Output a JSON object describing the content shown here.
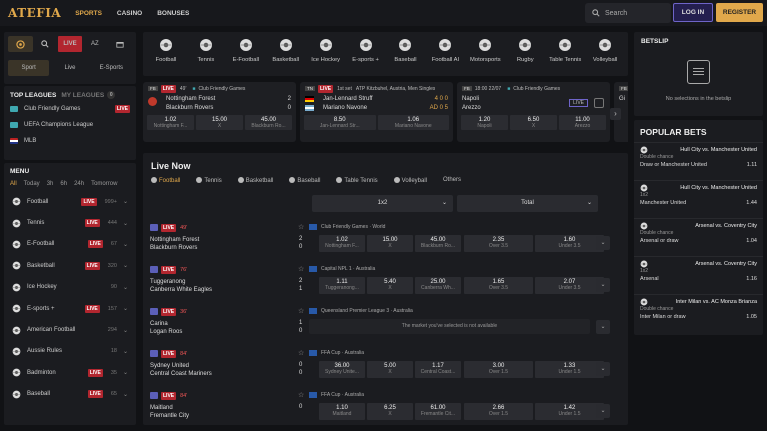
{
  "header": {
    "logo": "ATEFIA",
    "nav": [
      "SPORTS",
      "CASINO",
      "BONUSES"
    ],
    "search_placeholder": "Search",
    "login": "LOG IN",
    "register": "REGISTER"
  },
  "quick": {
    "live": "LIVE",
    "az": "AZ",
    "tabs": [
      "Sport",
      "Live",
      "E-Sports"
    ]
  },
  "top_leagues": {
    "title": "TOP LEAGUES",
    "sub": "MY LEAGUES",
    "count": "0",
    "items": [
      {
        "label": "Club Friendly Games",
        "live": "LIVE"
      },
      {
        "label": "UEFA Champions League",
        "live": ""
      },
      {
        "label": "MLB",
        "live": ""
      }
    ]
  },
  "menu": {
    "title": "MENU",
    "filters": [
      "All",
      "Today",
      "3h",
      "6h",
      "24h",
      "Tomorrow"
    ],
    "items": [
      {
        "label": "Football",
        "live": "LIVE",
        "count": "999+"
      },
      {
        "label": "Tennis",
        "live": "LIVE",
        "count": "444"
      },
      {
        "label": "E-Football",
        "live": "LIVE",
        "count": "67"
      },
      {
        "label": "Basketball",
        "live": "LIVE",
        "count": "320"
      },
      {
        "label": "Ice Hockey",
        "live": "",
        "count": "90"
      },
      {
        "label": "E-sports +",
        "live": "LIVE",
        "count": "157"
      },
      {
        "label": "American Football",
        "live": "",
        "count": "294"
      },
      {
        "label": "Aussie Rules",
        "live": "",
        "count": "18"
      },
      {
        "label": "Badminton",
        "live": "LIVE",
        "count": "35"
      },
      {
        "label": "Baseball",
        "live": "LIVE",
        "count": "65"
      }
    ]
  },
  "sports_bar": [
    "Football",
    "Tennis",
    "E-Football",
    "Basketball",
    "Ice Hockey",
    "E-sports +",
    "Baseball",
    "Football AI",
    "Motorsports",
    "Rugby",
    "Table Tennis",
    "Volleyball"
  ],
  "cards": [
    {
      "tag": "FB",
      "status": "LIVE",
      "minute": "49'",
      "comp": "Club Friendly Games",
      "team1": "Nottingham Forest",
      "team2": "Blackburn Rovers",
      "s1": "2",
      "s2": "0",
      "odds": [
        {
          "v": "1.02",
          "l": "Nottingham F..."
        },
        {
          "v": "15.00",
          "l": "X"
        },
        {
          "v": "45.00",
          "l": "Blackburn Ro..."
        }
      ]
    },
    {
      "tag": "TN",
      "status": "LIVE",
      "minute": "1st set",
      "comp": "ATP Kitzbuhel, Austria, Men Singles",
      "team1": "Jan-Lennard Struff",
      "team2": "Mariano Navone",
      "s1": "4  0  0",
      "s2": "AD  0  5",
      "odds": [
        {
          "v": "8.50",
          "l": "Jan-Lennard Str..."
        },
        {
          "v": "1.06",
          "l": "Mariano Navone"
        }
      ]
    },
    {
      "tag": "FB",
      "status": "18:00  22/07",
      "minute": "",
      "comp": "Club Friendly Games",
      "team1": "Napoli",
      "team2": "Arezzo",
      "live": "LIVE",
      "odds": [
        {
          "v": "1.20",
          "l": "Napoli"
        },
        {
          "v": "6.50",
          "l": "X"
        },
        {
          "v": "11.00",
          "l": "Arezzo"
        }
      ]
    },
    {
      "tag": "FB",
      "status": "",
      "minute": "",
      "comp": "",
      "team1": "Gi",
      "team2": "",
      "odds": []
    }
  ],
  "live_now": {
    "title": "Live Now",
    "tabs": [
      "Football",
      "Tennis",
      "Basketball",
      "Baseball",
      "Table Tennis",
      "Volleyball",
      "Others"
    ],
    "market1": "1x2",
    "market2": "Total",
    "events": [
      {
        "minute": "49'",
        "team1": "Nottingham Forest",
        "team2": "Blackburn Rovers",
        "s1": "2",
        "s2": "0",
        "comp": "Club Friendly Games · World",
        "odds": [
          {
            "v": "1.02",
            "l": "Nottingham F..."
          },
          {
            "v": "15.00",
            "l": "X"
          },
          {
            "v": "45.00",
            "l": "Blackburn Ro..."
          }
        ],
        "totals": [
          {
            "v": "2.35",
            "l": "Over 3.5"
          },
          {
            "v": "1.60",
            "l": "Under 3.5"
          }
        ]
      },
      {
        "minute": "76'",
        "team1": "Tuggeranong",
        "team2": "Canberra White Eagles",
        "s1": "2",
        "s2": "1",
        "comp": "Capital NPL 1 · Australia",
        "odds": [
          {
            "v": "1.11",
            "l": "Tuggeranong..."
          },
          {
            "v": "5.40",
            "l": "X"
          },
          {
            "v": "25.00",
            "l": "Canberra Wh..."
          }
        ],
        "totals": [
          {
            "v": "1.65",
            "l": "Over 3.5"
          },
          {
            "v": "2.07",
            "l": "Under 3.5"
          }
        ]
      },
      {
        "minute": "36'",
        "team1": "Carina",
        "team2": "Logan Roos",
        "s1": "1",
        "s2": "0",
        "comp": "Queensland Premier League 3 · Australia",
        "unavailable": "The market you've selected is not available"
      },
      {
        "minute": "84'",
        "team1": "Sydney United",
        "team2": "Central Coast Mariners",
        "s1": "0",
        "s2": "0",
        "comp": "FFA Cup · Australia",
        "odds": [
          {
            "v": "36.00",
            "l": "Sydney Unite..."
          },
          {
            "v": "5.00",
            "l": "X"
          },
          {
            "v": "1.17",
            "l": "Central Coast..."
          }
        ],
        "totals": [
          {
            "v": "3.00",
            "l": "Over 1.5"
          },
          {
            "v": "1.33",
            "l": "Under 1.5"
          }
        ]
      },
      {
        "minute": "84'",
        "team1": "Maitland",
        "team2": "Fremantle City",
        "s1": "0",
        "s2": "",
        "comp": "FFA Cup · Australia",
        "odds": [
          {
            "v": "1.10",
            "l": "Maitland"
          },
          {
            "v": "6.25",
            "l": "X"
          },
          {
            "v": "61.00",
            "l": "Fremantle Cit..."
          }
        ],
        "totals": [
          {
            "v": "2.66",
            "l": "Over 1.5"
          },
          {
            "v": "1.42",
            "l": "Under 1.5"
          }
        ]
      }
    ]
  },
  "betslip": {
    "title": "BETSLIP",
    "empty": "No selections in the betslip"
  },
  "popular": {
    "title": "POPULAR BETS",
    "items": [
      {
        "match": "Hull City vs. Manchester United",
        "type": "Double chance",
        "sel": "Draw or Manchester United",
        "odd": "1.11"
      },
      {
        "match": "Hull City vs. Manchester United",
        "type": "1x2",
        "sel": "Manchester United",
        "odd": "1.44"
      },
      {
        "match": "Arsenal vs. Coventry City",
        "type": "Double chance",
        "sel": "Arsenal or draw",
        "odd": "1.04"
      },
      {
        "match": "Arsenal vs. Coventry City",
        "type": "1x2",
        "sel": "Arsenal",
        "odd": "1.16"
      },
      {
        "match": "Inter Milan vs. AC Monza Brianza",
        "type": "Double chance",
        "sel": "Inter Milan or draw",
        "odd": "1.05"
      }
    ]
  }
}
